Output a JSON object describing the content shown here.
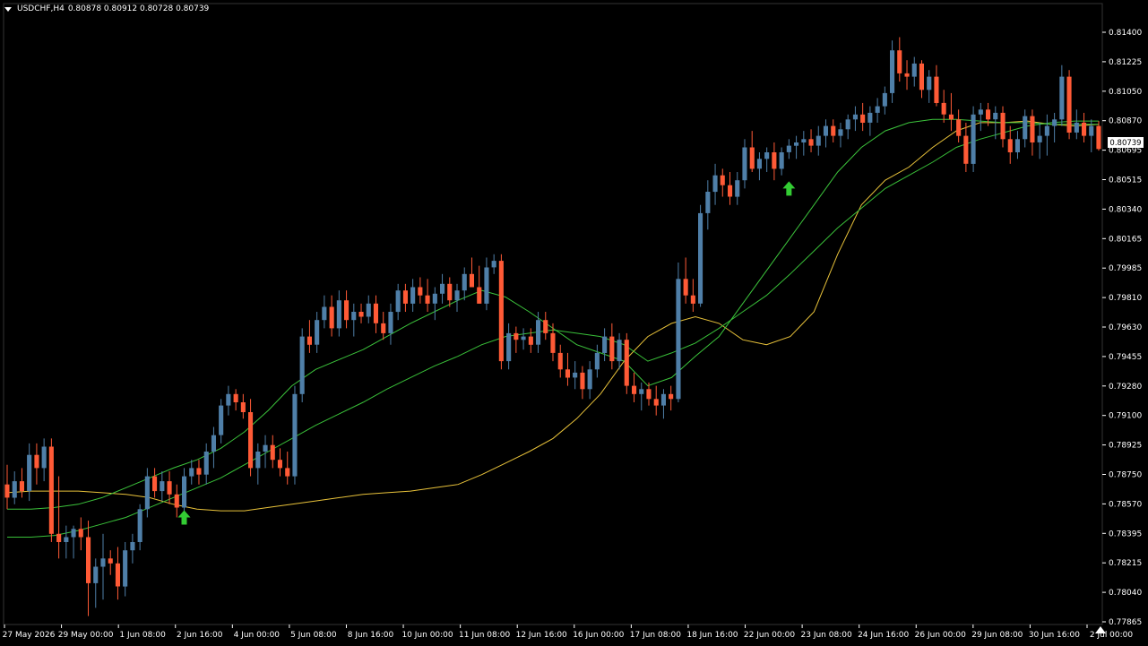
{
  "window": {
    "symbol": "USDCHF,H4",
    "ohlc": "0.80878 0.80912 0.80728 0.80739",
    "current_price": "0.80739"
  },
  "colors": {
    "background": "#000000",
    "bull": "#4f7fa8",
    "bear": "#ff5a36",
    "ma_fast": "#3cc43c",
    "ma_mid": "#39c039",
    "ma_slow": "#e8c23a",
    "arrow": "#33cc33",
    "axis": "#ffffff"
  },
  "chart_data": {
    "type": "candlestick",
    "title": "",
    "xlabel": "",
    "ylabel": "",
    "y_range": [
      0.77865,
      0.8149
    ],
    "y_ticks": [
      "0.81400",
      "0.81225",
      "0.81050",
      "0.80870",
      "0.80695",
      "0.80515",
      "0.80340",
      "0.80165",
      "0.79985",
      "0.79810",
      "0.79630",
      "0.79455",
      "0.79280",
      "0.79100",
      "0.78925",
      "0.78750",
      "0.78570",
      "0.78395",
      "0.78215",
      "0.78040",
      "0.77865"
    ],
    "x_ticks": [
      "27 May 2026",
      "29 May 00:00",
      "1 Jun 08:00",
      "2 Jun 16:00",
      "4 Jun 00:00",
      "5 Jun 08:00",
      "8 Jun 16:00",
      "10 Jun 00:00",
      "11 Jun 08:00",
      "12 Jun 16:00",
      "16 Jun 00:00",
      "17 Jun 08:00",
      "18 Jun 16:00",
      "22 Jun 00:00",
      "23 Jun 08:00",
      "24 Jun 16:00",
      "26 Jun 00:00",
      "29 Jun 08:00",
      "30 Jun 16:00",
      "2 Jul 00:00"
    ],
    "candles": [
      [
        0.787,
        0.7882,
        0.7855,
        0.7862
      ],
      [
        0.7862,
        0.7878,
        0.7858,
        0.7872
      ],
      [
        0.7872,
        0.788,
        0.7862,
        0.7866
      ],
      [
        0.7866,
        0.7895,
        0.786,
        0.7888
      ],
      [
        0.7888,
        0.7895,
        0.787,
        0.788
      ],
      [
        0.788,
        0.7898,
        0.7872,
        0.7893
      ],
      [
        0.7893,
        0.7898,
        0.7835,
        0.784
      ],
      [
        0.784,
        0.7875,
        0.7825,
        0.7835
      ],
      [
        0.7835,
        0.7845,
        0.7825,
        0.7838
      ],
      [
        0.7838,
        0.7845,
        0.7825,
        0.7843
      ],
      [
        0.7843,
        0.785,
        0.783,
        0.7838
      ],
      [
        0.7838,
        0.7848,
        0.779,
        0.781
      ],
      [
        0.781,
        0.7825,
        0.7795,
        0.782
      ],
      [
        0.782,
        0.784,
        0.78,
        0.7825
      ],
      [
        0.7825,
        0.783,
        0.7815,
        0.7822
      ],
      [
        0.7822,
        0.7832,
        0.78,
        0.7808
      ],
      [
        0.7808,
        0.7835,
        0.7802,
        0.783
      ],
      [
        0.783,
        0.784,
        0.7822,
        0.7835
      ],
      [
        0.7835,
        0.7858,
        0.783,
        0.7855
      ],
      [
        0.7855,
        0.788,
        0.785,
        0.7875
      ],
      [
        0.7875,
        0.788,
        0.7862,
        0.7866
      ],
      [
        0.7866,
        0.7878,
        0.786,
        0.7872
      ],
      [
        0.7872,
        0.7878,
        0.7858,
        0.7864
      ],
      [
        0.7864,
        0.787,
        0.785,
        0.7856
      ],
      [
        0.7856,
        0.788,
        0.785,
        0.7875
      ],
      [
        0.7875,
        0.7885,
        0.787,
        0.788
      ],
      [
        0.788,
        0.7885,
        0.787,
        0.7876
      ],
      [
        0.7876,
        0.7895,
        0.787,
        0.789
      ],
      [
        0.789,
        0.7905,
        0.788,
        0.79
      ],
      [
        0.79,
        0.7922,
        0.7895,
        0.7918
      ],
      [
        0.7918,
        0.793,
        0.7912,
        0.7925
      ],
      [
        0.7925,
        0.7928,
        0.7915,
        0.792
      ],
      [
        0.792,
        0.7925,
        0.791,
        0.7914
      ],
      [
        0.7914,
        0.7922,
        0.7875,
        0.788
      ],
      [
        0.788,
        0.7895,
        0.787,
        0.789
      ],
      [
        0.789,
        0.79,
        0.788,
        0.7894
      ],
      [
        0.7894,
        0.79,
        0.788,
        0.7885
      ],
      [
        0.7885,
        0.7892,
        0.7875,
        0.788
      ],
      [
        0.788,
        0.789,
        0.787,
        0.7875
      ],
      [
        0.7875,
        0.793,
        0.787,
        0.7925
      ],
      [
        0.7925,
        0.7965,
        0.792,
        0.796
      ],
      [
        0.796,
        0.797,
        0.795,
        0.7955
      ],
      [
        0.7955,
        0.7975,
        0.795,
        0.797
      ],
      [
        0.797,
        0.7985,
        0.7965,
        0.7978
      ],
      [
        0.7978,
        0.7985,
        0.796,
        0.7965
      ],
      [
        0.7965,
        0.7988,
        0.796,
        0.7982
      ],
      [
        0.7982,
        0.7988,
        0.7965,
        0.797
      ],
      [
        0.797,
        0.798,
        0.796,
        0.7975
      ],
      [
        0.7975,
        0.798,
        0.7968,
        0.7972
      ],
      [
        0.7972,
        0.7985,
        0.7968,
        0.798
      ],
      [
        0.798,
        0.7985,
        0.7962,
        0.7968
      ],
      [
        0.7968,
        0.7975,
        0.7958,
        0.7962
      ],
      [
        0.7962,
        0.798,
        0.7955,
        0.7975
      ],
      [
        0.7975,
        0.7992,
        0.797,
        0.7988
      ],
      [
        0.7988,
        0.7992,
        0.7975,
        0.798
      ],
      [
        0.798,
        0.7995,
        0.7975,
        0.799
      ],
      [
        0.799,
        0.7996,
        0.798,
        0.7985
      ],
      [
        0.7985,
        0.7995,
        0.7975,
        0.798
      ],
      [
        0.798,
        0.799,
        0.797,
        0.7986
      ],
      [
        0.7986,
        0.7998,
        0.798,
        0.7992
      ],
      [
        0.7992,
        0.7996,
        0.7978,
        0.7982
      ],
      [
        0.7982,
        0.7992,
        0.7975,
        0.7988
      ],
      [
        0.7988,
        0.8002,
        0.7982,
        0.7998
      ],
      [
        0.7998,
        0.8008,
        0.799,
        0.799
      ],
      [
        0.799,
        0.8003,
        0.798,
        0.798
      ],
      [
        0.798,
        0.8008,
        0.7976,
        0.8002
      ],
      [
        0.8002,
        0.801,
        0.7998,
        0.8006
      ],
      [
        0.8006,
        0.801,
        0.794,
        0.7945
      ],
      [
        0.7945,
        0.7968,
        0.794,
        0.7962
      ],
      [
        0.7962,
        0.7966,
        0.795,
        0.7958
      ],
      [
        0.7958,
        0.7965,
        0.7952,
        0.796
      ],
      [
        0.796,
        0.7965,
        0.795,
        0.7955
      ],
      [
        0.7955,
        0.7975,
        0.795,
        0.797
      ],
      [
        0.797,
        0.7975,
        0.7958,
        0.7962
      ],
      [
        0.7962,
        0.7968,
        0.7945,
        0.795
      ],
      [
        0.795,
        0.7955,
        0.7935,
        0.794
      ],
      [
        0.794,
        0.795,
        0.793,
        0.7935
      ],
      [
        0.7935,
        0.7945,
        0.7928,
        0.7938
      ],
      [
        0.7938,
        0.7942,
        0.7922,
        0.7928
      ],
      [
        0.7928,
        0.7945,
        0.7922,
        0.794
      ],
      [
        0.794,
        0.7955,
        0.7935,
        0.795
      ],
      [
        0.795,
        0.7965,
        0.7945,
        0.796
      ],
      [
        0.796,
        0.7968,
        0.794,
        0.7945
      ],
      [
        0.7945,
        0.7962,
        0.794,
        0.7958
      ],
      [
        0.7958,
        0.7962,
        0.7925,
        0.793
      ],
      [
        0.793,
        0.7938,
        0.792,
        0.7925
      ],
      [
        0.7925,
        0.7932,
        0.7915,
        0.7928
      ],
      [
        0.7928,
        0.7932,
        0.7918,
        0.7922
      ],
      [
        0.7922,
        0.793,
        0.7912,
        0.7918
      ],
      [
        0.7918,
        0.7928,
        0.791,
        0.7925
      ],
      [
        0.7925,
        0.793,
        0.7915,
        0.7922
      ],
      [
        0.7922,
        0.8005,
        0.792,
        0.7995
      ],
      [
        0.7995,
        0.8008,
        0.798,
        0.7985
      ],
      [
        0.7985,
        0.7995,
        0.7975,
        0.798
      ],
      [
        0.798,
        0.804,
        0.7978,
        0.8035
      ],
      [
        0.8035,
        0.8055,
        0.8025,
        0.8048
      ],
      [
        0.8048,
        0.8065,
        0.804,
        0.8058
      ],
      [
        0.8058,
        0.8062,
        0.8045,
        0.8052
      ],
      [
        0.8052,
        0.806,
        0.804,
        0.8045
      ],
      [
        0.8045,
        0.806,
        0.804,
        0.8055
      ],
      [
        0.8055,
        0.808,
        0.805,
        0.8075
      ],
      [
        0.8075,
        0.8085,
        0.806,
        0.8062
      ],
      [
        0.8062,
        0.8072,
        0.8055,
        0.8068
      ],
      [
        0.8068,
        0.8075,
        0.806,
        0.8072
      ],
      [
        0.8072,
        0.8078,
        0.8055,
        0.8062
      ],
      [
        0.8062,
        0.8075,
        0.8058,
        0.8072
      ],
      [
        0.8072,
        0.808,
        0.8068,
        0.8076
      ],
      [
        0.8076,
        0.8082,
        0.8068,
        0.8078
      ],
      [
        0.8078,
        0.8085,
        0.807,
        0.808
      ],
      [
        0.808,
        0.8086,
        0.8072,
        0.8076
      ],
      [
        0.8076,
        0.8088,
        0.807,
        0.8082
      ],
      [
        0.8082,
        0.8092,
        0.8075,
        0.8088
      ],
      [
        0.8088,
        0.8092,
        0.8078,
        0.8082
      ],
      [
        0.8082,
        0.809,
        0.8075,
        0.8086
      ],
      [
        0.8086,
        0.8095,
        0.808,
        0.8092
      ],
      [
        0.8092,
        0.81,
        0.8085,
        0.8095
      ],
      [
        0.8095,
        0.8102,
        0.8085,
        0.809
      ],
      [
        0.809,
        0.81,
        0.8082,
        0.8096
      ],
      [
        0.8096,
        0.8105,
        0.809,
        0.81
      ],
      [
        0.81,
        0.8112,
        0.8095,
        0.8108
      ],
      [
        0.8108,
        0.814,
        0.8102,
        0.8134
      ],
      [
        0.8134,
        0.8142,
        0.8115,
        0.812
      ],
      [
        0.812,
        0.8128,
        0.811,
        0.8118
      ],
      [
        0.8118,
        0.813,
        0.8112,
        0.8126
      ],
      [
        0.8126,
        0.8128,
        0.8105,
        0.811
      ],
      [
        0.811,
        0.8122,
        0.8102,
        0.8118
      ],
      [
        0.8118,
        0.8125,
        0.81,
        0.8102
      ],
      [
        0.8102,
        0.811,
        0.809,
        0.8095
      ],
      [
        0.8095,
        0.8108,
        0.8085,
        0.8092
      ],
      [
        0.8092,
        0.8098,
        0.8078,
        0.8082
      ],
      [
        0.8082,
        0.809,
        0.806,
        0.8065
      ],
      [
        0.8065,
        0.81,
        0.806,
        0.8095
      ],
      [
        0.8095,
        0.8102,
        0.8085,
        0.8098
      ],
      [
        0.8098,
        0.8102,
        0.8088,
        0.8092
      ],
      [
        0.8092,
        0.81,
        0.808,
        0.8096
      ],
      [
        0.8096,
        0.81,
        0.8075,
        0.808
      ],
      [
        0.808,
        0.8088,
        0.8065,
        0.8072
      ],
      [
        0.8072,
        0.8085,
        0.8068,
        0.808
      ],
      [
        0.808,
        0.8098,
        0.8075,
        0.8094
      ],
      [
        0.8094,
        0.8098,
        0.807,
        0.8078
      ],
      [
        0.8078,
        0.809,
        0.8068,
        0.8082
      ],
      [
        0.8082,
        0.8095,
        0.807,
        0.8088
      ],
      [
        0.8088,
        0.8096,
        0.8078,
        0.8092
      ],
      [
        0.8092,
        0.8125,
        0.8088,
        0.8118
      ],
      [
        0.8118,
        0.8122,
        0.808,
        0.8084
      ],
      [
        0.8084,
        0.8098,
        0.808,
        0.809
      ],
      [
        0.809,
        0.8096,
        0.8078,
        0.8082
      ],
      [
        0.8082,
        0.8092,
        0.8072,
        0.8088
      ],
      [
        0.8088,
        0.8091,
        0.8073,
        0.8074
      ]
    ],
    "ma_slow": [
      0.7865,
      0.7866,
      0.7866,
      0.7866,
      0.7865,
      0.7864,
      0.7862,
      0.7858,
      0.7855,
      0.7854,
      0.7854,
      0.7856,
      0.7858,
      0.786,
      0.7862,
      0.7864,
      0.7865,
      0.7866,
      0.7868,
      0.787,
      0.7876,
      0.7883,
      0.789,
      0.7898,
      0.791,
      0.7925,
      0.7945,
      0.796,
      0.7968,
      0.7972,
      0.7968,
      0.7958,
      0.7955,
      0.796,
      0.7975,
      0.801,
      0.804,
      0.8055,
      0.8063,
      0.8075,
      0.8085,
      0.809,
      0.809,
      0.8091,
      0.8089,
      0.8088,
      0.8089
    ],
    "ma_fast": [
      0.7855,
      0.7855,
      0.7856,
      0.7858,
      0.7862,
      0.7868,
      0.7874,
      0.788,
      0.7885,
      0.7892,
      0.7902,
      0.7915,
      0.793,
      0.794,
      0.7946,
      0.7952,
      0.796,
      0.7968,
      0.7975,
      0.7982,
      0.7988,
      0.7984,
      0.7975,
      0.7965,
      0.7955,
      0.795,
      0.7945,
      0.793,
      0.7935,
      0.7948,
      0.796,
      0.798,
      0.8,
      0.802,
      0.804,
      0.806,
      0.8075,
      0.8085,
      0.809,
      0.8092,
      0.8092,
      0.8091,
      0.809,
      0.809,
      0.8089,
      0.8089,
      0.8089
    ],
    "ma_mid": [
      0.7838,
      0.7838,
      0.7839,
      0.7842,
      0.7846,
      0.785,
      0.7856,
      0.7862,
      0.7868,
      0.7874,
      0.7882,
      0.789,
      0.7898,
      0.7906,
      0.7913,
      0.792,
      0.7928,
      0.7935,
      0.7942,
      0.7948,
      0.7955,
      0.796,
      0.7962,
      0.7964,
      0.7962,
      0.796,
      0.7955,
      0.7945,
      0.795,
      0.7956,
      0.7965,
      0.7975,
      0.7985,
      0.7998,
      0.8012,
      0.8026,
      0.8038,
      0.805,
      0.8058,
      0.8066,
      0.8075,
      0.808,
      0.8084,
      0.8088,
      0.809,
      0.8091,
      0.8091
    ],
    "arrows": [
      {
        "index": 24,
        "price": 0.785,
        "direction": "up"
      },
      {
        "index": 106,
        "price": 0.805,
        "direction": "up"
      }
    ]
  }
}
